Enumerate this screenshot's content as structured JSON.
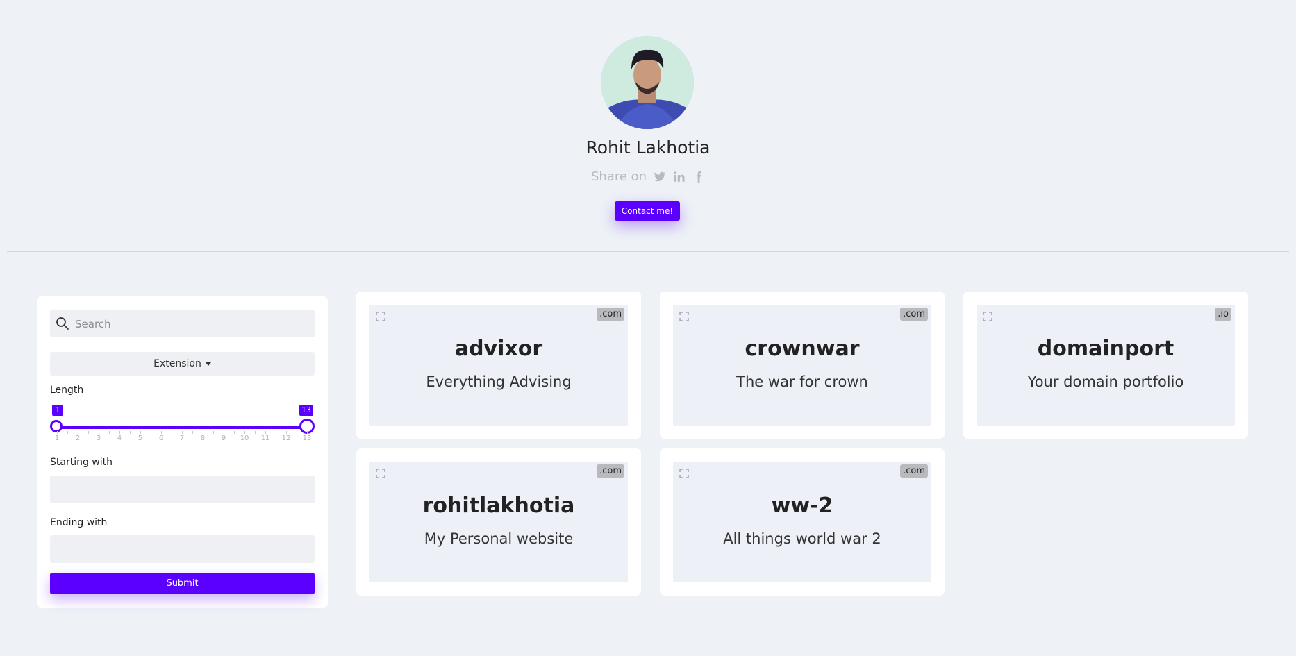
{
  "profile": {
    "name": "Rohit Lakhotia",
    "share_label": "Share on",
    "share_icons": [
      "twitter-icon",
      "linkedin-icon",
      "facebook-icon"
    ],
    "contact_label": "Contact me!"
  },
  "filters": {
    "search_placeholder": "Search",
    "extension_label": "Extension",
    "length_label": "Length",
    "length_min": "1",
    "length_max": "13",
    "length_ticks": [
      "1",
      "2",
      "3",
      "4",
      "5",
      "6",
      "7",
      "8",
      "9",
      "10",
      "11",
      "12",
      "13"
    ],
    "starting_label": "Starting with",
    "starting_value": "",
    "ending_label": "Ending with",
    "ending_value": "",
    "submit_label": "Submit"
  },
  "domains": [
    {
      "name": "advixor",
      "tagline": "Everything Advising",
      "ext": ".com"
    },
    {
      "name": "crownwar",
      "tagline": "The war for crown",
      "ext": ".com"
    },
    {
      "name": "domainport",
      "tagline": "Your domain portfolio",
      "ext": ".io"
    },
    {
      "name": "rohitlakhotia",
      "tagline": "My Personal website",
      "ext": ".com"
    },
    {
      "name": "ww-2",
      "tagline": "All things world war 2",
      "ext": ".com"
    }
  ],
  "colors": {
    "accent": "#5b00ff",
    "background": "#eef1f6",
    "card_inner": "#eef0f7",
    "ext_badge": "#b9babe"
  }
}
